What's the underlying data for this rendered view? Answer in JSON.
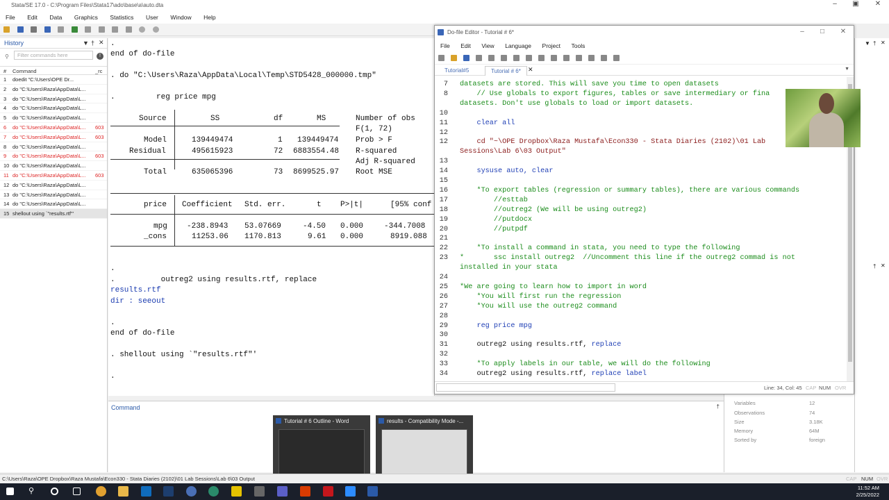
{
  "stata": {
    "title": "Stata/SE 17.0 - C:\\Program Files\\Stata17\\ado\\base\\a\\auto.dta",
    "menu": [
      "File",
      "Edit",
      "Data",
      "Graphics",
      "Statistics",
      "User",
      "Window",
      "Help"
    ]
  },
  "history": {
    "title": "History",
    "filter_placeholder": "Filter commands here",
    "col_command": "Command",
    "col_rc": "_rc",
    "items": [
      {
        "n": "1",
        "cmd": "doedit \"C:\\Users\\OPE Dr...",
        "rc": "",
        "err": false
      },
      {
        "n": "2",
        "cmd": "do \"C:\\Users\\Raza\\AppData\\L...",
        "rc": "",
        "err": false
      },
      {
        "n": "3",
        "cmd": "do \"C:\\Users\\Raza\\AppData\\L...",
        "rc": "",
        "err": false
      },
      {
        "n": "4",
        "cmd": "do \"C:\\Users\\Raza\\AppData\\L...",
        "rc": "",
        "err": false
      },
      {
        "n": "5",
        "cmd": "do \"C:\\Users\\Raza\\AppData\\L...",
        "rc": "",
        "err": false
      },
      {
        "n": "6",
        "cmd": "do \"C:\\Users\\Raza\\AppData\\L...",
        "rc": "603",
        "err": true
      },
      {
        "n": "7",
        "cmd": "do \"C:\\Users\\Raza\\AppData\\L...",
        "rc": "603",
        "err": true
      },
      {
        "n": "8",
        "cmd": "do \"C:\\Users\\Raza\\AppData\\L...",
        "rc": "",
        "err": false
      },
      {
        "n": "9",
        "cmd": "do \"C:\\Users\\Raza\\AppData\\L...",
        "rc": "603",
        "err": true
      },
      {
        "n": "10",
        "cmd": "do \"C:\\Users\\Raza\\AppData\\L...",
        "rc": "",
        "err": false
      },
      {
        "n": "11",
        "cmd": "do \"C:\\Users\\Raza\\AppData\\L...",
        "rc": "603",
        "err": true
      },
      {
        "n": "12",
        "cmd": "do \"C:\\Users\\Raza\\AppData\\L...",
        "rc": "",
        "err": false
      },
      {
        "n": "13",
        "cmd": "do \"C:\\Users\\Raza\\AppData\\L...",
        "rc": "",
        "err": false
      },
      {
        "n": "14",
        "cmd": "do \"C:\\Users\\Raza\\AppData\\L...",
        "rc": "",
        "err": false
      },
      {
        "n": "15",
        "cmd": "shellout using `\"results.rtf\"'",
        "rc": "",
        "err": false
      }
    ]
  },
  "results": {
    "l1": ".",
    "l2": "end of do-file",
    "l3": ". do \"C:\\Users\\Raza\\AppData\\Local\\Temp\\STD5428_000000.tmp\"",
    "l4": ".         reg price mpg",
    "hdr_source": "Source",
    "hdr_ss": "SS",
    "hdr_df": "df",
    "hdr_ms": "MS",
    "model": "Model",
    "model_ss": "139449474",
    "model_df": "1",
    "model_ms": "139449474",
    "residual": "Residual",
    "res_ss": "495615923",
    "res_df": "72",
    "res_ms": "6883554.48",
    "total": "Total",
    "tot_ss": "635065396",
    "tot_df": "73",
    "tot_ms": "8699525.97",
    "stat1": "Number of obs",
    "stat2": "F(1, 72)",
    "stat3": "Prob > F",
    "stat4": "R-squared",
    "stat5": "Adj R-squared",
    "stat6": "Root MSE",
    "h_price": "price",
    "h_coef": "Coefficient",
    "h_se": "Std. err.",
    "h_t": "t",
    "h_p": "P>|t|",
    "h_ci": "[95% conf",
    "mpg": "mpg",
    "mpg_coef": "-238.8943",
    "mpg_se": "53.07669",
    "mpg_t": "-4.50",
    "mpg_p": "0.000",
    "mpg_ci": "-344.7008",
    "cons": "_cons",
    "cons_coef": "11253.06",
    "cons_se": "1170.813",
    "cons_t": "9.61",
    "cons_p": "0.000",
    "cons_ci": "8919.088",
    "l5": ".",
    "l6": ".          outreg2 using results.rtf, replace",
    "l7": "results.rtf",
    "l8": "dir : seeout",
    "l9": ".",
    "l10": "end of do-file",
    "l11": ". shellout using `\"results.rtf\"'",
    "l12": "."
  },
  "command": {
    "label": "Command"
  },
  "doedit": {
    "title": "Do-file Editor - Tutorial # 6*",
    "menu": [
      "File",
      "Edit",
      "View",
      "Language",
      "Project",
      "Tools"
    ],
    "tab1": "Tutorial#5",
    "tab2": "Tutorial # 6*",
    "status_pos": "Line: 34, Col: 45",
    "status_cap": "CAP",
    "status_num": "NUM",
    "status_ovr": "OVR",
    "lines": [
      {
        "n": "7",
        "t": "datasets are stored. This will save you time to open datasets",
        "c": "green"
      },
      {
        "n": "8",
        "t": "    // Use globals to export figures, tables or save intermediary or fina",
        "c": "green"
      },
      {
        "n": "",
        "t": "datasets. Don't use globals to load or import datasets.",
        "c": "green"
      },
      {
        "n": "10",
        "t": "",
        "c": ""
      },
      {
        "n": "11",
        "t": "    clear all",
        "c": "blue"
      },
      {
        "n": "12",
        "t": "",
        "c": ""
      },
      {
        "n": "12",
        "t": "    cd \"~\\OPE Dropbox\\Raza Mustafa\\Econ330 - Stata Diaries (2102)\\01 Lab",
        "c": "str"
      },
      {
        "n": "",
        "t": "Sessions\\Lab 6\\03 Output\"",
        "c": "str"
      },
      {
        "n": "13",
        "t": "",
        "c": ""
      },
      {
        "n": "14",
        "t": "    sysuse auto, clear",
        "c": "blue"
      },
      {
        "n": "15",
        "t": "",
        "c": ""
      },
      {
        "n": "16",
        "t": "    *To export tables (regression or summary tables), there are various commands",
        "c": "green"
      },
      {
        "n": "17",
        "t": "        //esttab",
        "c": "green"
      },
      {
        "n": "18",
        "t": "        //outreg2 (We will be using outreg2)",
        "c": "green"
      },
      {
        "n": "19",
        "t": "        //putdocx",
        "c": "green"
      },
      {
        "n": "20",
        "t": "        //putpdf",
        "c": "green"
      },
      {
        "n": "21",
        "t": "",
        "c": ""
      },
      {
        "n": "22",
        "t": "    *To install a command in stata, you need to type the following",
        "c": "green"
      },
      {
        "n": "23",
        "t": "*       ssc install outreg2  //Uncomment this line if the outreg2 commad is not",
        "c": "green"
      },
      {
        "n": "",
        "t": "installed in your stata",
        "c": "green"
      },
      {
        "n": "24",
        "t": "",
        "c": ""
      },
      {
        "n": "25",
        "t": "*We are going to learn how to import in word",
        "c": "green"
      },
      {
        "n": "26",
        "t": "    *You will first run the regression",
        "c": "green"
      },
      {
        "n": "27",
        "t": "    *You will use the outreg2 command",
        "c": "green"
      },
      {
        "n": "28",
        "t": "",
        "c": ""
      },
      {
        "n": "29",
        "t": "    reg price mpg",
        "c": "blue"
      },
      {
        "n": "30",
        "t": "",
        "c": ""
      },
      {
        "n": "31",
        "t": "    outreg2 using results.rtf, replace",
        "c": "mixed1"
      },
      {
        "n": "32",
        "t": "",
        "c": ""
      },
      {
        "n": "33",
        "t": "    *To apply labels in our table, we will do the following",
        "c": "green"
      },
      {
        "n": "34",
        "t": "    outreg2 using results.rtf, replace label",
        "c": "mixed2"
      }
    ]
  },
  "properties": {
    "variables_label": "Variables",
    "variables_val": "12",
    "obs_label": "Observations",
    "obs_val": "74",
    "size_label": "Size",
    "size_val": "3.18K",
    "mem_label": "Memory",
    "mem_val": "64M",
    "sorted_label": "Sorted by",
    "sorted_val": "foreign"
  },
  "previews": {
    "word1": "Tutorial # 6 Outline - Word",
    "word2": "results  -  Compatibility Mode -..."
  },
  "statusbar": {
    "path": "C:\\Users\\Raza\\OPE Dropbox\\Raza Mustafa\\Econ330 - Stata Diaries (2102)\\01 Lab Sessions\\Lab 6\\03 Output",
    "cap": "CAP",
    "num": "NUM",
    "ovr": "OVR"
  },
  "clock": {
    "time": "11:52 AM",
    "date": "2/25/2022"
  }
}
